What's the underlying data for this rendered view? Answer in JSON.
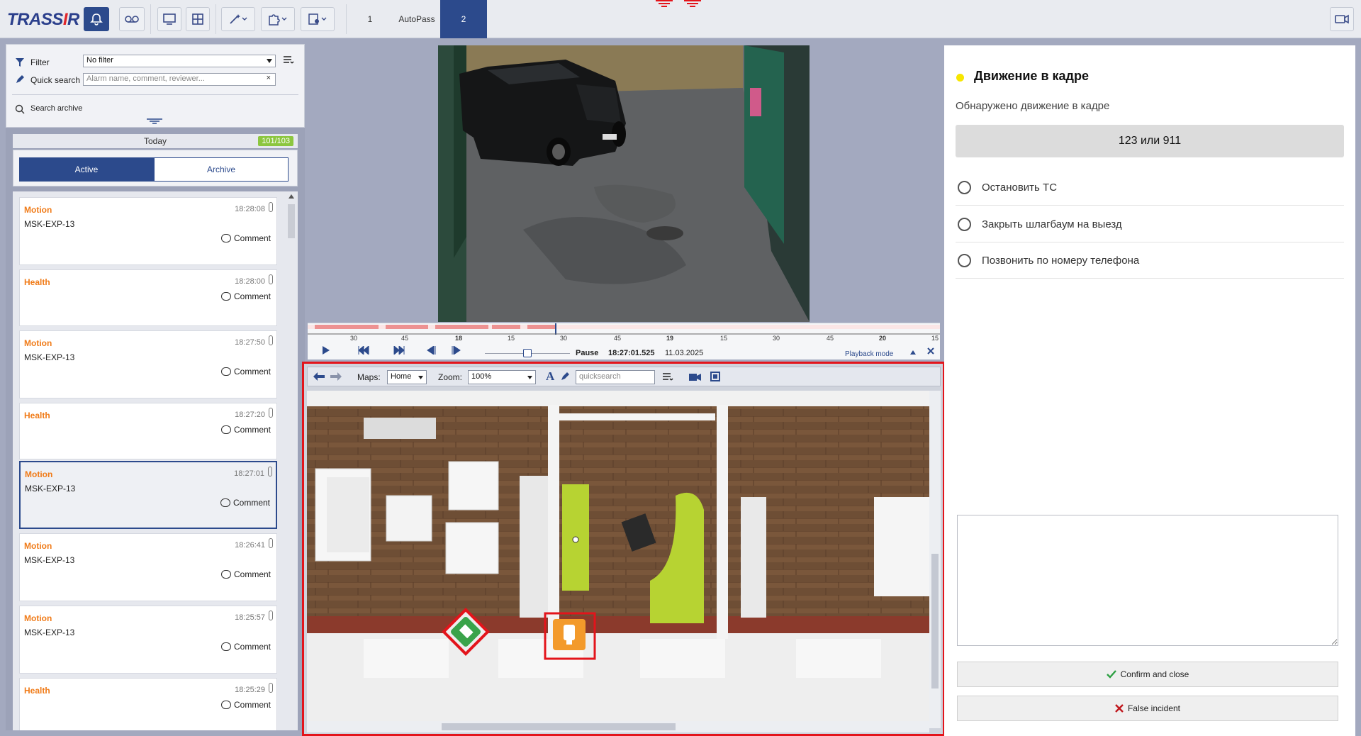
{
  "app": {
    "logo": "TRASSIR"
  },
  "toolbar": {
    "tabs": [
      "1",
      "AutoPass",
      "2"
    ],
    "active_tab": "2",
    "accent": "#2c4a8c"
  },
  "filter": {
    "filter_label": "Filter",
    "filter_value": "No filter",
    "quick_label": "Quick search",
    "quick_placeholder": "Alarm name, comment, reviewer...",
    "search_archive": "Search archive"
  },
  "list_header": {
    "day": "Today",
    "count": "101/103"
  },
  "segments": {
    "active": "Active",
    "archive": "Archive"
  },
  "alarms": [
    {
      "type": "Motion",
      "time": "18:28:08",
      "object": "MSK-EXP-13",
      "comment": "Comment"
    },
    {
      "type": "Health",
      "time": "18:28:00",
      "object": "",
      "comment": "Comment"
    },
    {
      "type": "Motion",
      "time": "18:27:50",
      "object": "MSK-EXP-13",
      "comment": "Comment"
    },
    {
      "type": "Health",
      "time": "18:27:20",
      "object": "",
      "comment": "Comment"
    },
    {
      "type": "Motion",
      "time": "18:27:01",
      "object": "MSK-EXP-13",
      "comment": "Comment",
      "selected": true
    },
    {
      "type": "Motion",
      "time": "18:26:41",
      "object": "MSK-EXP-13",
      "comment": "Comment"
    },
    {
      "type": "Motion",
      "time": "18:25:57",
      "object": "MSK-EXP-13",
      "comment": "Comment"
    },
    {
      "type": "Health",
      "time": "18:25:29",
      "object": "",
      "comment": "Comment"
    }
  ],
  "timeline": {
    "ticks": [
      "30",
      "45",
      "18",
      "15",
      "30",
      "45",
      "19",
      "15",
      "30",
      "45",
      "20",
      "15"
    ],
    "state": "Pause",
    "time": "18:27:01.525",
    "date": "11.03.2025",
    "mode": "Playback mode"
  },
  "map": {
    "maps_label": "Maps:",
    "maps_value": "Home",
    "zoom_label": "Zoom:",
    "zoom_value": "100%",
    "search_placeholder": "quicksearch"
  },
  "incident": {
    "title": "Движение в кадре",
    "subtitle": "Обнаружено движение в кадре",
    "phone": "123 или 911",
    "options": [
      "Остановить ТС",
      "Закрыть шлагбаум на выезд",
      "Позвонить по номеру телефона"
    ],
    "confirm": "Confirm and close",
    "false": "False incident"
  }
}
